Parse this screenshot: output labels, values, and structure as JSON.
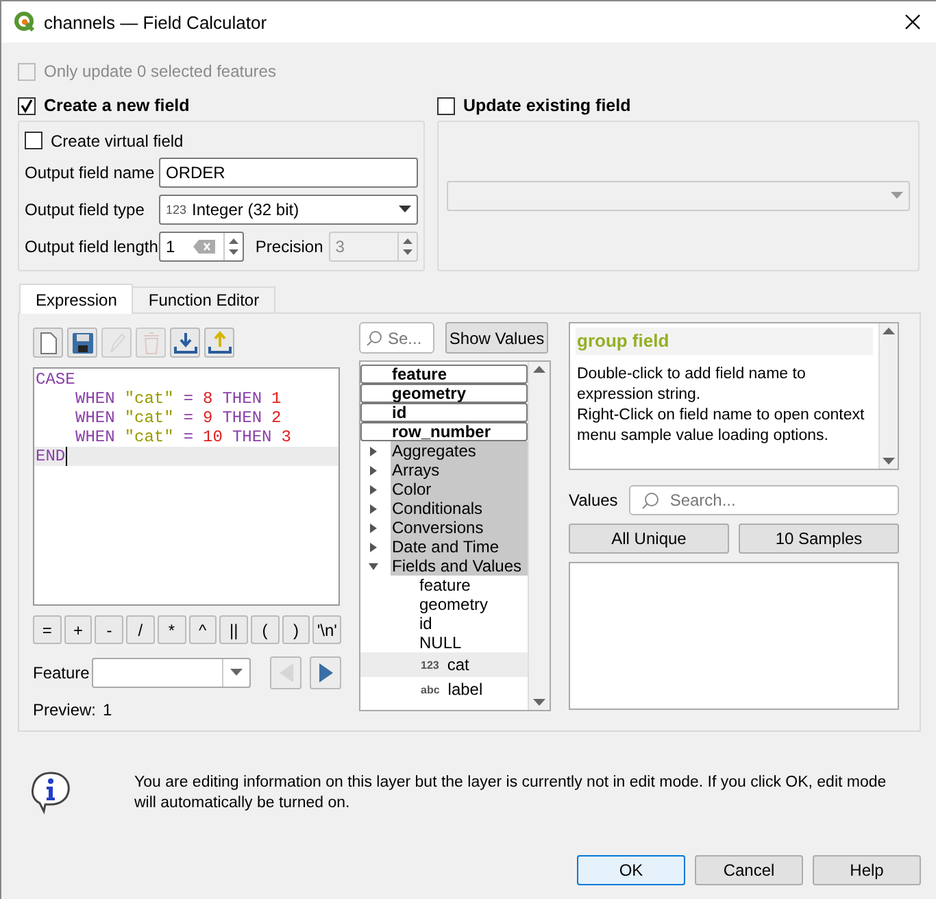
{
  "window": {
    "title": "channels — Field Calculator"
  },
  "only_selected": {
    "label": "Only update 0 selected features",
    "checked": false,
    "disabled": true
  },
  "create_field": {
    "label": "Create a new field",
    "checked": true,
    "virtual": {
      "label": "Create virtual field",
      "checked": false
    },
    "name": {
      "label": "Output field name",
      "value": "ORDER"
    },
    "type": {
      "label": "Output field type",
      "badge": "123",
      "value": "Integer (32 bit)"
    },
    "length": {
      "label": "Output field length",
      "value": "1"
    },
    "precision": {
      "label": "Precision",
      "value": "3",
      "disabled": true
    }
  },
  "update_field": {
    "label": "Update existing field",
    "checked": false
  },
  "tabs": [
    {
      "label": "Expression",
      "selected": true
    },
    {
      "label": "Function Editor",
      "selected": false
    }
  ],
  "toolbar": [
    {
      "kind": "new",
      "disabled": false
    },
    {
      "kind": "save",
      "disabled": false
    },
    {
      "kind": "edit",
      "disabled": true
    },
    {
      "kind": "delete",
      "disabled": true
    },
    {
      "kind": "import",
      "disabled": false
    },
    {
      "kind": "export",
      "disabled": false
    }
  ],
  "editor": {
    "lines": [
      {
        "tokens": [
          {
            "kind": "keyword",
            "text": "CASE"
          }
        ],
        "current": false,
        "children": [
          {
            "tokens": [
              {
                "kind": "keyword",
                "text": "WHEN"
              },
              {
                "kind": "string",
                "text": "\"cat\""
              },
              {
                "kind": "operator",
                "text": "="
              },
              {
                "kind": "number",
                "text": "8"
              },
              {
                "kind": "keyword",
                "text": "THEN"
              },
              {
                "kind": "number",
                "text": "1"
              }
            ],
            "current": false
          },
          {
            "tokens": [
              {
                "kind": "keyword",
                "text": "WHEN"
              },
              {
                "kind": "string",
                "text": "\"cat\""
              },
              {
                "kind": "operator",
                "text": "="
              },
              {
                "kind": "number",
                "text": "9"
              },
              {
                "kind": "keyword",
                "text": "THEN"
              },
              {
                "kind": "number",
                "text": "2"
              }
            ],
            "current": false
          },
          {
            "tokens": [
              {
                "kind": "keyword",
                "text": "WHEN"
              },
              {
                "kind": "string",
                "text": "\"cat\""
              },
              {
                "kind": "operator",
                "text": "="
              },
              {
                "kind": "number",
                "text": "10"
              },
              {
                "kind": "keyword",
                "text": "THEN"
              },
              {
                "kind": "number",
                "text": "3"
              }
            ],
            "current": false
          }
        ]
      },
      {
        "tokens": [
          {
            "kind": "keyword",
            "text": "END"
          }
        ],
        "current": true
      }
    ]
  },
  "operators": [
    "=",
    "+",
    "-",
    "/",
    "*",
    "^",
    "||",
    "(",
    ")",
    "'\\n'"
  ],
  "feature": {
    "label": "Feature",
    "previous_disabled": true,
    "next_disabled": false
  },
  "preview": {
    "label": "Preview:",
    "value": "1"
  },
  "function_search": {
    "placeholder": "Se..."
  },
  "show_values": "Show Values",
  "tree": [
    {
      "label": "feature",
      "kind": "field",
      "selected": false
    },
    {
      "label": "geometry",
      "kind": "field",
      "selected": false
    },
    {
      "label": "id",
      "kind": "field",
      "selected": false
    },
    {
      "label": "row_number",
      "kind": "field",
      "selected": false
    },
    {
      "label": "Aggregates",
      "kind": "group",
      "expanded": false,
      "selected": false
    },
    {
      "label": "Arrays",
      "kind": "group",
      "expanded": false,
      "selected": false
    },
    {
      "label": "Color",
      "kind": "group",
      "expanded": false,
      "selected": false
    },
    {
      "label": "Conditionals",
      "kind": "group",
      "expanded": false,
      "selected": false
    },
    {
      "label": "Conversions",
      "kind": "group",
      "expanded": false,
      "selected": false
    },
    {
      "label": "Date and Time",
      "kind": "group",
      "expanded": false,
      "selected": false
    },
    {
      "label": "Fields and Values",
      "kind": "group",
      "expanded": true,
      "selected": false,
      "children": [
        {
          "label": "feature",
          "kind": "item",
          "selected": false
        },
        {
          "label": "geometry",
          "kind": "item",
          "selected": false
        },
        {
          "label": "id",
          "kind": "item",
          "selected": false
        },
        {
          "label": "NULL",
          "kind": "item",
          "selected": false
        },
        {
          "label": "cat",
          "kind": "item",
          "badge": "123",
          "selected": true
        },
        {
          "label": "label",
          "kind": "item",
          "badge": "abc",
          "selected": false
        }
      ]
    }
  ],
  "help": {
    "title": "group field",
    "lines": [
      "Double-click to add field name to expression string.",
      "Right-Click on field name to open context menu sample value loading options."
    ]
  },
  "values": {
    "label": "Values",
    "placeholder": "Search...",
    "buttons": [
      "All Unique",
      "10 Samples"
    ]
  },
  "message": "You are editing information on this layer but the layer is currently not in edit mode. If you click OK, edit mode will automatically be turned on.",
  "buttons": [
    {
      "label": "OK",
      "default": true
    },
    {
      "label": "Cancel",
      "default": false
    },
    {
      "label": "Help",
      "default": false
    }
  ]
}
